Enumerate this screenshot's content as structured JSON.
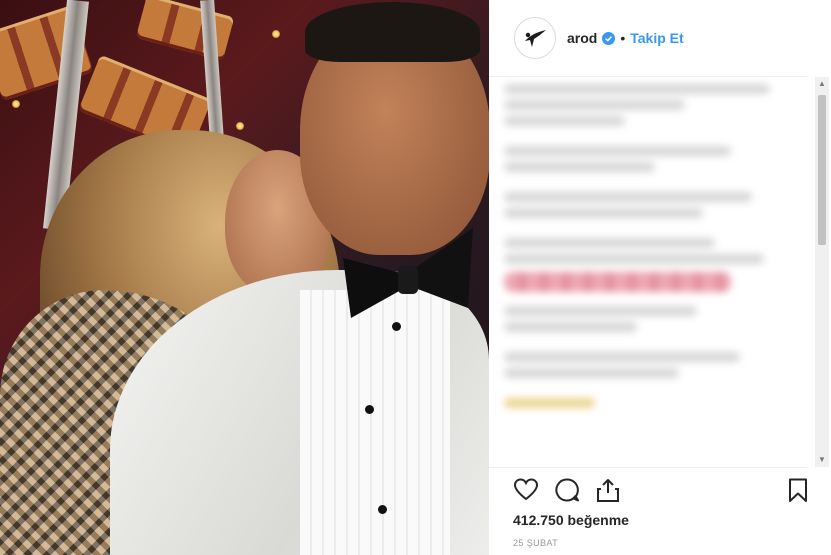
{
  "post": {
    "username": "arod",
    "separator": "•",
    "follow_label": "Takip Et",
    "likes_text": "412.750 beğenme",
    "date_text": "25 ŞUBAT"
  },
  "icons": {
    "verified": "verified-badge-icon",
    "like": "heart-icon",
    "comment": "comment-bubble-icon",
    "share": "share-upload-icon",
    "save": "bookmark-icon"
  },
  "colors": {
    "link_blue": "#3897f0",
    "text": "#262626",
    "muted": "#999999",
    "divider": "#efefef"
  }
}
